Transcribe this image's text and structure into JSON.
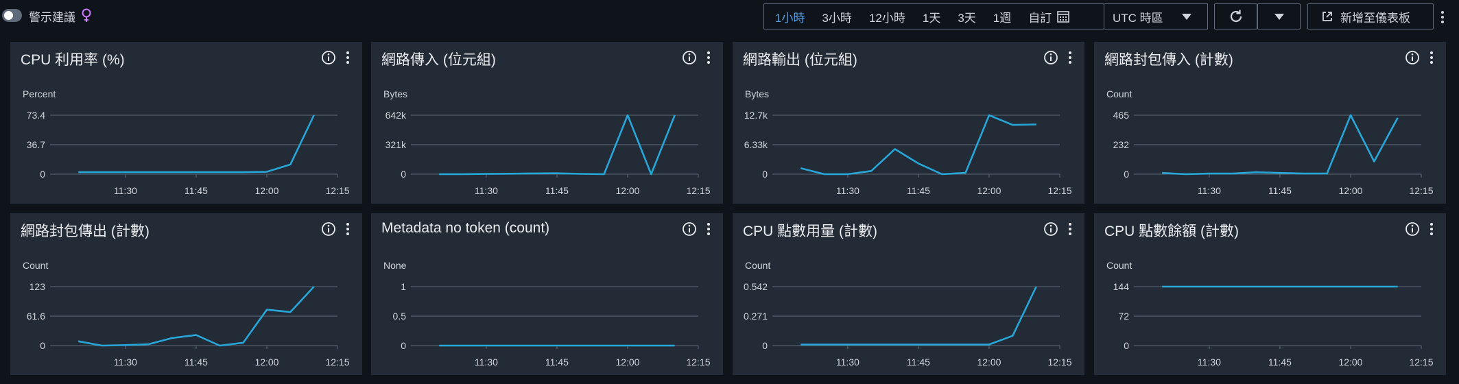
{
  "topbar": {
    "alarm_toggle_label": "警示建議",
    "time_ranges": [
      "1小時",
      "3小時",
      "12小時",
      "1天",
      "3天",
      "1週"
    ],
    "active_range": "1小時",
    "custom_label": "自訂",
    "timezone_label": "UTC 時區",
    "add_dashboard_label": "新增至儀表板"
  },
  "colors": {
    "line": "#27a6d8",
    "grid": "#5f6b7a",
    "active": "#539fe5"
  },
  "widgets": [
    {
      "title": "CPU 利用率 (%)",
      "unit": "Percent",
      "y_ticks": [
        "73.4",
        "36.7",
        "0"
      ],
      "x_ticks": [
        "11:30",
        "11:45",
        "12:00",
        "12:15"
      ]
    },
    {
      "title": "網路傳入 (位元組)",
      "unit": "Bytes",
      "y_ticks": [
        "642k",
        "321k",
        "0"
      ],
      "x_ticks": [
        "11:30",
        "11:45",
        "12:00",
        "12:15"
      ]
    },
    {
      "title": "網路輸出 (位元組)",
      "unit": "Bytes",
      "y_ticks": [
        "12.7k",
        "6.33k",
        "0"
      ],
      "x_ticks": [
        "11:30",
        "11:45",
        "12:00",
        "12:15"
      ]
    },
    {
      "title": "網路封包傳入 (計數)",
      "unit": "Count",
      "y_ticks": [
        "465",
        "232",
        "0"
      ],
      "x_ticks": [
        "11:30",
        "11:45",
        "12:00",
        "12:15"
      ]
    },
    {
      "title": "網路封包傳出 (計數)",
      "unit": "Count",
      "y_ticks": [
        "123",
        "61.6",
        "0"
      ],
      "x_ticks": [
        "11:30",
        "11:45",
        "12:00",
        "12:15"
      ]
    },
    {
      "title": "Metadata no token (count)",
      "unit": "None",
      "y_ticks": [
        "1",
        "0.5",
        "0"
      ],
      "x_ticks": [
        "11:30",
        "11:45",
        "12:00",
        "12:15"
      ]
    },
    {
      "title": "CPU 點數用量 (計數)",
      "unit": "Count",
      "y_ticks": [
        "0.542",
        "0.271",
        "0"
      ],
      "x_ticks": [
        "11:30",
        "11:45",
        "12:00",
        "12:15"
      ]
    },
    {
      "title": "CPU 點數餘額 (計數)",
      "unit": "Count",
      "y_ticks": [
        "144",
        "72",
        "0"
      ],
      "x_ticks": [
        "11:30",
        "11:45",
        "12:00",
        "12:15"
      ]
    }
  ],
  "chart_data": [
    {
      "type": "line",
      "title": "CPU 利用率 (%)",
      "ylabel": "Percent",
      "ylim": [
        0,
        73.4
      ],
      "x": [
        "11:20",
        "11:25",
        "11:30",
        "11:35",
        "11:40",
        "11:45",
        "11:50",
        "11:55",
        "12:00",
        "12:05",
        "12:10"
      ],
      "series": [
        {
          "values": [
            2.5,
            2.5,
            2.5,
            2.5,
            2.5,
            2.5,
            2.5,
            2.5,
            3,
            12,
            73.4
          ]
        }
      ]
    },
    {
      "type": "line",
      "title": "網路傳入 (位元組)",
      "ylabel": "Bytes",
      "ylim": [
        0,
        642000
      ],
      "x": [
        "11:20",
        "11:25",
        "11:30",
        "11:35",
        "11:40",
        "11:45",
        "11:50",
        "11:55",
        "12:00",
        "12:05",
        "12:10"
      ],
      "series": [
        {
          "values": [
            0,
            0,
            3000,
            5000,
            8000,
            10000,
            4000,
            0,
            642000,
            0,
            642000
          ]
        }
      ]
    },
    {
      "type": "line",
      "title": "網路輸出 (位元組)",
      "ylabel": "Bytes",
      "ylim": [
        0,
        12700
      ],
      "x": [
        "11:20",
        "11:25",
        "11:30",
        "11:35",
        "11:40",
        "11:45",
        "11:50",
        "11:55",
        "12:00",
        "12:05",
        "12:10"
      ],
      "series": [
        {
          "values": [
            1300,
            0,
            0,
            700,
            5400,
            2300,
            0,
            300,
            12700,
            10600,
            10700
          ]
        }
      ]
    },
    {
      "type": "line",
      "title": "網路封包傳入 (計數)",
      "ylabel": "Count",
      "ylim": [
        0,
        465
      ],
      "x": [
        "11:20",
        "11:25",
        "11:30",
        "11:35",
        "11:40",
        "11:45",
        "11:50",
        "11:55",
        "12:00",
        "12:05",
        "12:10"
      ],
      "series": [
        {
          "values": [
            10,
            0,
            5,
            5,
            15,
            10,
            5,
            5,
            465,
            100,
            445
          ]
        }
      ]
    },
    {
      "type": "line",
      "title": "網路封包傳出 (計數)",
      "ylabel": "Count",
      "ylim": [
        0,
        123
      ],
      "x": [
        "11:20",
        "11:25",
        "11:30",
        "11:35",
        "11:40",
        "11:45",
        "11:50",
        "11:55",
        "12:00",
        "12:05",
        "12:10"
      ],
      "series": [
        {
          "values": [
            9,
            0,
            1,
            3,
            16,
            22,
            0,
            6,
            75,
            70,
            123
          ]
        }
      ]
    },
    {
      "type": "line",
      "title": "Metadata no token (count)",
      "ylabel": "None",
      "ylim": [
        0,
        1
      ],
      "x": [
        "11:20",
        "11:25",
        "11:30",
        "11:35",
        "11:40",
        "11:45",
        "11:50",
        "11:55",
        "12:00",
        "12:05",
        "12:10"
      ],
      "series": [
        {
          "values": [
            0,
            0,
            0,
            0,
            0,
            0,
            0,
            0,
            0,
            0,
            0
          ]
        }
      ]
    },
    {
      "type": "line",
      "title": "CPU 點數用量 (計數)",
      "ylabel": "Count",
      "ylim": [
        0,
        0.542
      ],
      "x": [
        "11:20",
        "11:25",
        "11:30",
        "11:35",
        "11:40",
        "11:45",
        "11:50",
        "11:55",
        "12:00",
        "12:05",
        "12:10"
      ],
      "series": [
        {
          "values": [
            0.01,
            0.01,
            0.01,
            0.01,
            0.01,
            0.01,
            0.01,
            0.01,
            0.01,
            0.09,
            0.542
          ]
        }
      ]
    },
    {
      "type": "line",
      "title": "CPU 點數餘額 (計數)",
      "ylabel": "Count",
      "ylim": [
        0,
        144
      ],
      "x": [
        "11:20",
        "11:25",
        "11:30",
        "11:35",
        "11:40",
        "11:45",
        "11:50",
        "11:55",
        "12:00",
        "12:05",
        "12:10"
      ],
      "series": [
        {
          "values": [
            144,
            144,
            144,
            144,
            144,
            144,
            144,
            144,
            144,
            144,
            144
          ]
        }
      ]
    }
  ]
}
